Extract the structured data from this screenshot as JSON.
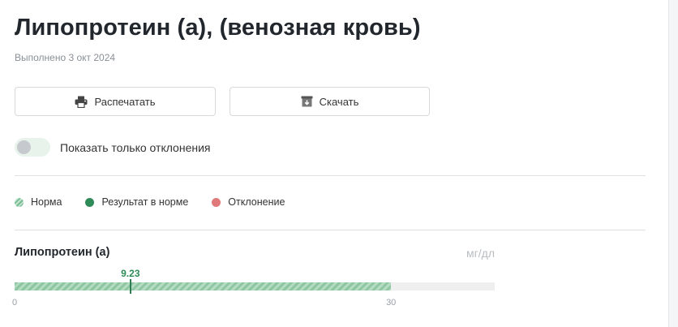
{
  "header": {
    "title": "Липопротеин (а), (венозная кровь)",
    "subtitle": "Выполнено 3 окт 2024"
  },
  "actions": {
    "print_label": "Распечатать",
    "print_icon": "printer-icon",
    "download_label": "Скачать",
    "download_icon": "download-icon"
  },
  "filter": {
    "toggle_label": "Показать только отклонения",
    "toggle_on": false
  },
  "legend": [
    {
      "label": "Норма",
      "color": "#78bc93"
    },
    {
      "label": "Результат в норме",
      "color": "#2e8b57"
    },
    {
      "label": "Отклонение",
      "color": "#e07a7a"
    }
  ],
  "metric": {
    "name": "Липопротеин (а)",
    "unit": "мг/дл",
    "value": 9.23,
    "value_label": "9.23",
    "norm_min": 0,
    "norm_max": 30,
    "scale_max": 38.26,
    "ticks": [
      "0",
      "30"
    ]
  }
}
